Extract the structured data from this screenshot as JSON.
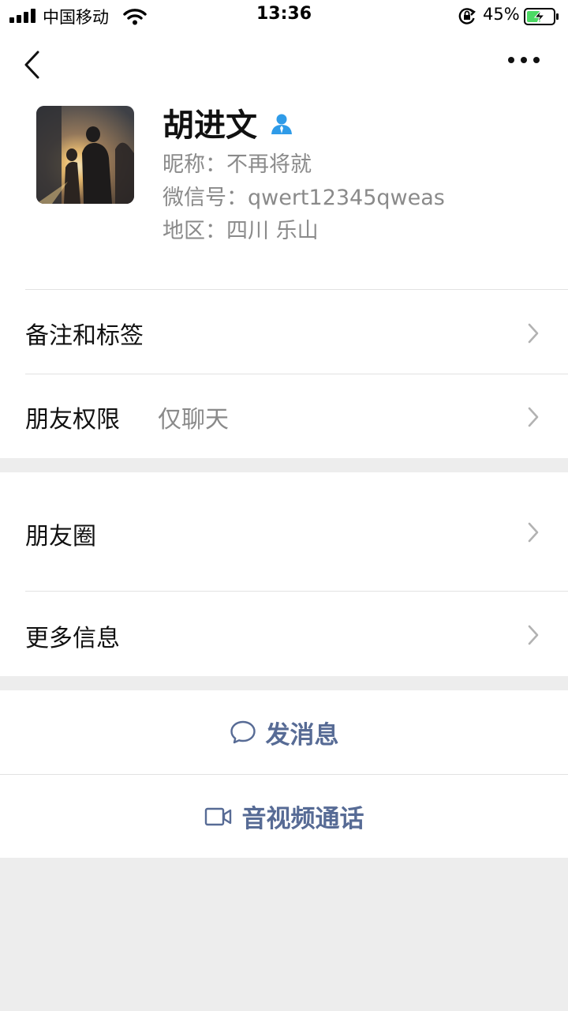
{
  "status_bar": {
    "carrier": "中国移动",
    "time": "13:36",
    "battery_percent": "45%"
  },
  "nav": {
    "back_icon": "chevron-left-icon",
    "more_icon": "more-dots-icon"
  },
  "profile": {
    "name": "胡进文",
    "nickname": "昵称：不再将就",
    "wechat_id": "微信号：qwert12345qweas",
    "region": "地区：四川 乐山"
  },
  "rows": {
    "remark": {
      "label": "备注和标签"
    },
    "permission": {
      "label": "朋友权限",
      "value": "仅聊天"
    },
    "moments": {
      "label": "朋友圈"
    },
    "more_info": {
      "label": "更多信息"
    }
  },
  "actions": {
    "message": "发消息",
    "call": "音视频通话"
  },
  "colors": {
    "link": "#576b95",
    "background": "#ededed",
    "badge_blue": "#2f9be8",
    "battery_green": "#4cd964"
  }
}
